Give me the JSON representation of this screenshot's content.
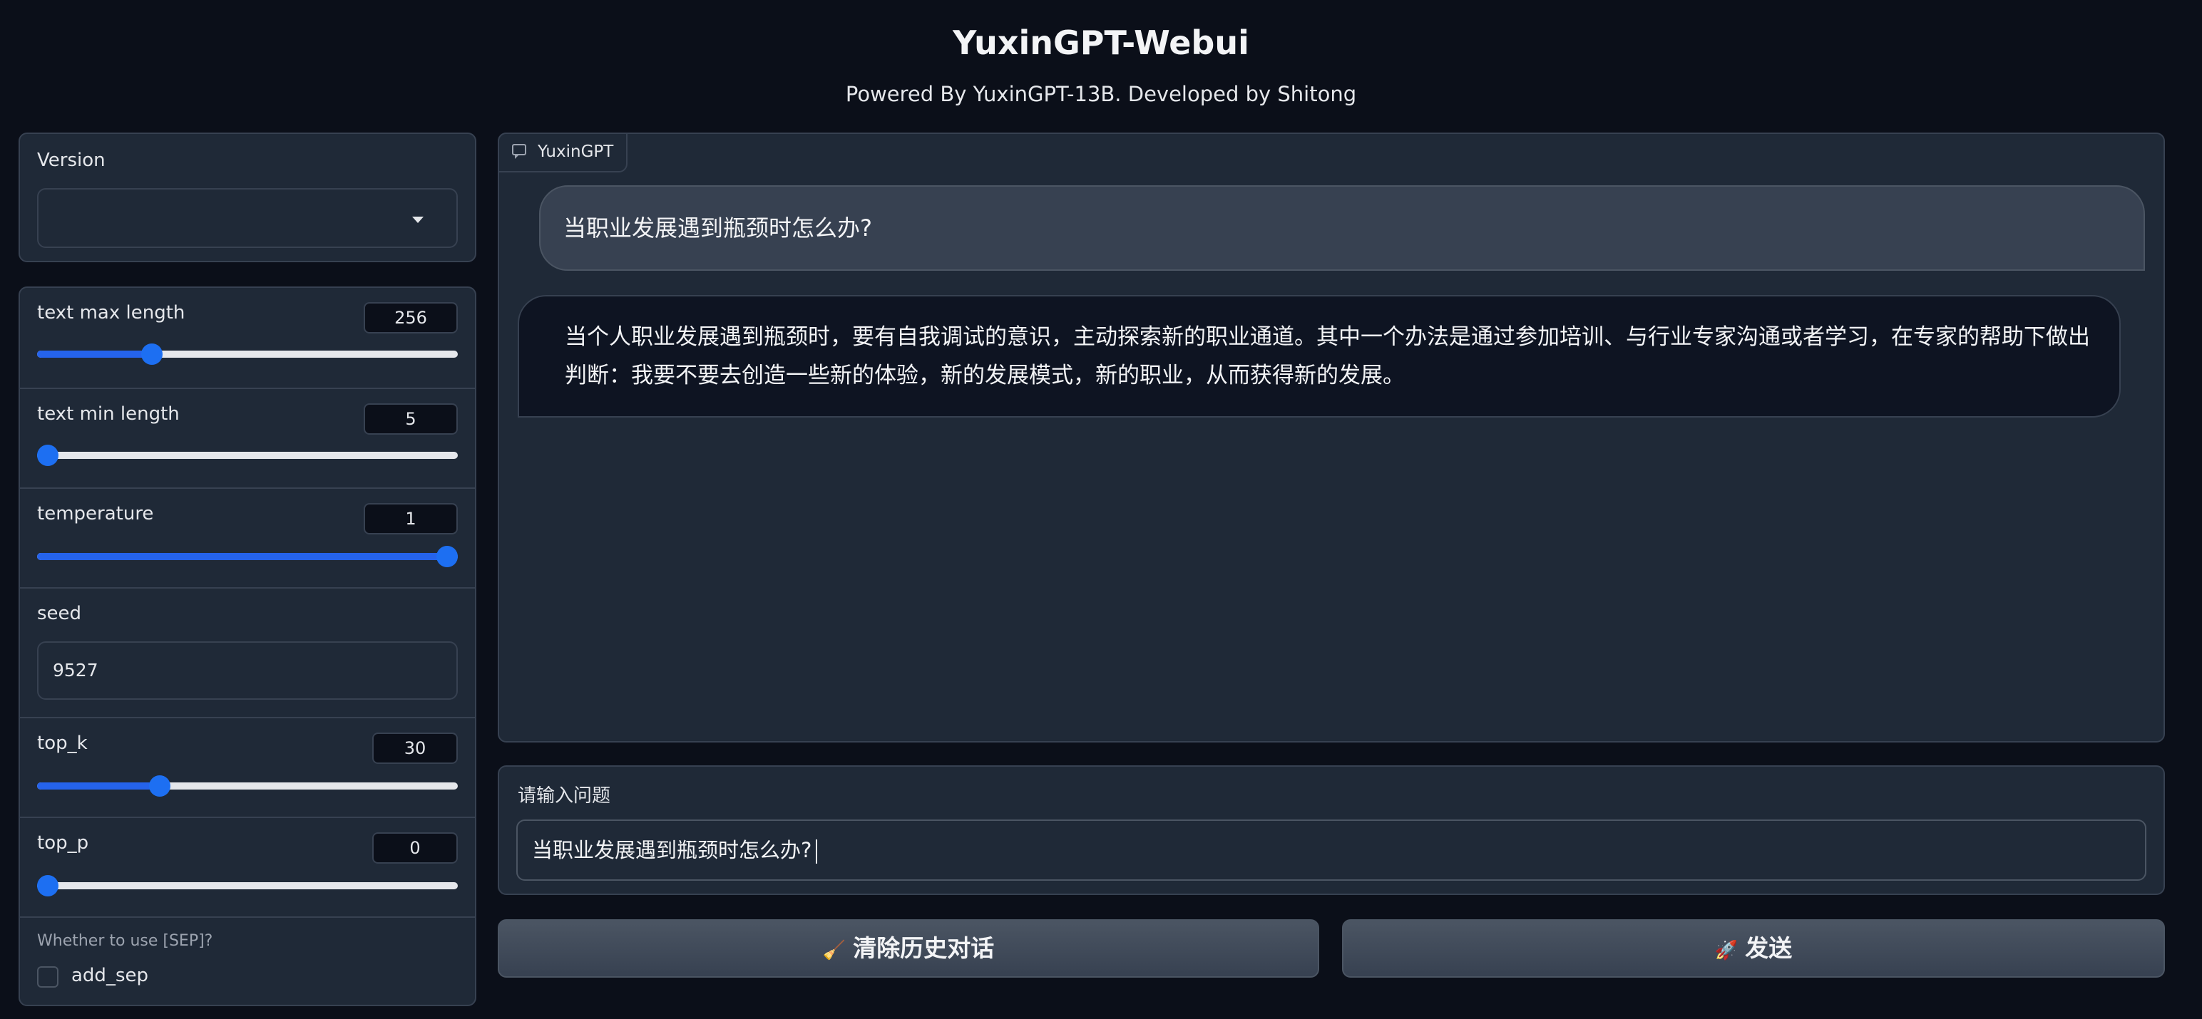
{
  "header": {
    "title": "YuxinGPT-Webui",
    "subtitle": "Powered By YuxinGPT-13B. Developed by Shitong"
  },
  "sidebar": {
    "version": {
      "label": "Version",
      "value": ""
    },
    "params": {
      "text_max_length": {
        "label": "text max length",
        "value": "256",
        "fraction": 0.26
      },
      "text_min_length": {
        "label": "text min length",
        "value": "5",
        "fraction": 0.0
      },
      "temperature": {
        "label": "temperature",
        "value": "1",
        "fraction": 1.0
      },
      "seed": {
        "label": "seed",
        "value": "9527"
      },
      "top_k": {
        "label": "top_k",
        "value": "30",
        "fraction": 0.28
      },
      "top_p": {
        "label": "top_p",
        "value": "0",
        "fraction": 0.0
      }
    },
    "sep": {
      "info": "Whether to use [SEP]?",
      "checkbox_label": "add_sep",
      "checked": false
    }
  },
  "chat": {
    "tab_label": "YuxinGPT",
    "messages": [
      {
        "role": "user",
        "text": "当职业发展遇到瓶颈时怎么办?"
      },
      {
        "role": "bot",
        "text": "当个人职业发展遇到瓶颈时，要有自我调试的意识，主动探索新的职业通道。其中一个办法是通过参加培训、与行业专家沟通或者学习，在专家的帮助下做出判断：我要不要去创造一些新的体验，新的发展模式，新的职业，从而获得新的发展。"
      }
    ]
  },
  "input": {
    "label": "请输入问题",
    "value": "当职业发展遇到瓶颈时怎么办?"
  },
  "buttons": {
    "clear_icon": "🧹",
    "clear_label": "清除历史对话",
    "send_icon": "🚀",
    "send_label": "发送"
  },
  "colors": {
    "background": "#0b0f19",
    "panel": "#1f2937",
    "border": "#374151",
    "accent": "#2563eb"
  }
}
